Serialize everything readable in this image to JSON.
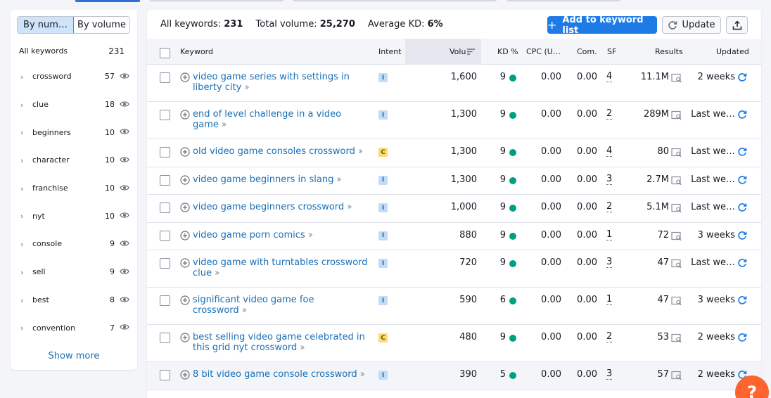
{
  "sidebar": {
    "toggle": {
      "by_number": "By num…",
      "by_volume": "By volume"
    },
    "header": {
      "label": "All keywords",
      "count": "231"
    },
    "groups": [
      {
        "label": "crossword",
        "count": "57"
      },
      {
        "label": "clue",
        "count": "18"
      },
      {
        "label": "beginners",
        "count": "10"
      },
      {
        "label": "character",
        "count": "10"
      },
      {
        "label": "franchise",
        "count": "10"
      },
      {
        "label": "nyt",
        "count": "10"
      },
      {
        "label": "console",
        "count": "9"
      },
      {
        "label": "sell",
        "count": "9"
      },
      {
        "label": "best",
        "count": "8"
      },
      {
        "label": "convention",
        "count": "7"
      }
    ],
    "show_more": "Show more"
  },
  "summary": {
    "all_label": "All keywords:",
    "all_value": "231",
    "vol_label": "Total volume:",
    "vol_value": "25,270",
    "kd_label": "Average KD:",
    "kd_value": "6%"
  },
  "toolbar": {
    "add_label": "Add to keyword list",
    "update_label": "Update"
  },
  "columns": {
    "keyword": "Keyword",
    "intent": "Intent",
    "volume": "Volu",
    "kd": "KD %",
    "cpc": "CPC (U…",
    "com": "Com.",
    "sf": "SF",
    "results": "Results",
    "updated": "Updated"
  },
  "rows": [
    {
      "keyword": "video game series with settings in liberty city",
      "intent": "I",
      "volume": "1,600",
      "kd": "9",
      "cpc": "0.00",
      "com": "0.00",
      "sf": "4",
      "results": "11.1M",
      "updated": "2 weeks",
      "lines": 2
    },
    {
      "keyword": "end of level challenge in a video game",
      "intent": "I",
      "volume": "1,300",
      "kd": "9",
      "cpc": "0.00",
      "com": "0.00",
      "sf": "2",
      "results": "289M",
      "updated": "Last we…",
      "lines": 2
    },
    {
      "keyword": "old video game consoles crossword",
      "intent": "C",
      "volume": "1,300",
      "kd": "9",
      "cpc": "0.00",
      "com": "0.00",
      "sf": "4",
      "results": "80",
      "updated": "Last we…",
      "lines": 1
    },
    {
      "keyword": "video game beginners in slang",
      "intent": "I",
      "volume": "1,300",
      "kd": "9",
      "cpc": "0.00",
      "com": "0.00",
      "sf": "3",
      "results": "2.7M",
      "updated": "Last we…",
      "lines": 1
    },
    {
      "keyword": "video game beginners crossword",
      "intent": "I",
      "volume": "1,000",
      "kd": "9",
      "cpc": "0.00",
      "com": "0.00",
      "sf": "2",
      "results": "5.1M",
      "updated": "Last we…",
      "lines": 1
    },
    {
      "keyword": "video game porn comics",
      "intent": "I",
      "volume": "880",
      "kd": "9",
      "cpc": "0.00",
      "com": "0.00",
      "sf": "1",
      "results": "72",
      "updated": "3 weeks",
      "lines": 1
    },
    {
      "keyword": "video game with turntables crossword clue",
      "intent": "I",
      "volume": "720",
      "kd": "9",
      "cpc": "0.00",
      "com": "0.00",
      "sf": "3",
      "results": "47",
      "updated": "Last we…",
      "lines": 2
    },
    {
      "keyword": "significant video game foe crossword",
      "intent": "I",
      "volume": "590",
      "kd": "6",
      "cpc": "0.00",
      "com": "0.00",
      "sf": "1",
      "results": "47",
      "updated": "3 weeks",
      "lines": 2
    },
    {
      "keyword": "best selling video game celebrated in this grid nyt crossword",
      "intent": "C",
      "volume": "480",
      "kd": "9",
      "cpc": "0.00",
      "com": "0.00",
      "sf": "2",
      "results": "53",
      "updated": "2 weeks",
      "lines": 2
    },
    {
      "keyword": "8 bit video game console crossword",
      "intent": "I",
      "volume": "390",
      "kd": "5",
      "cpc": "0.00",
      "com": "0.00",
      "sf": "3",
      "results": "57",
      "updated": "2 weeks",
      "lines": 1
    }
  ],
  "colors": {
    "accent": "#1e7be6",
    "link": "#1a6fb6",
    "kd_easy": "#009f81",
    "help": "#ff642d"
  },
  "help": {
    "label": "?"
  }
}
